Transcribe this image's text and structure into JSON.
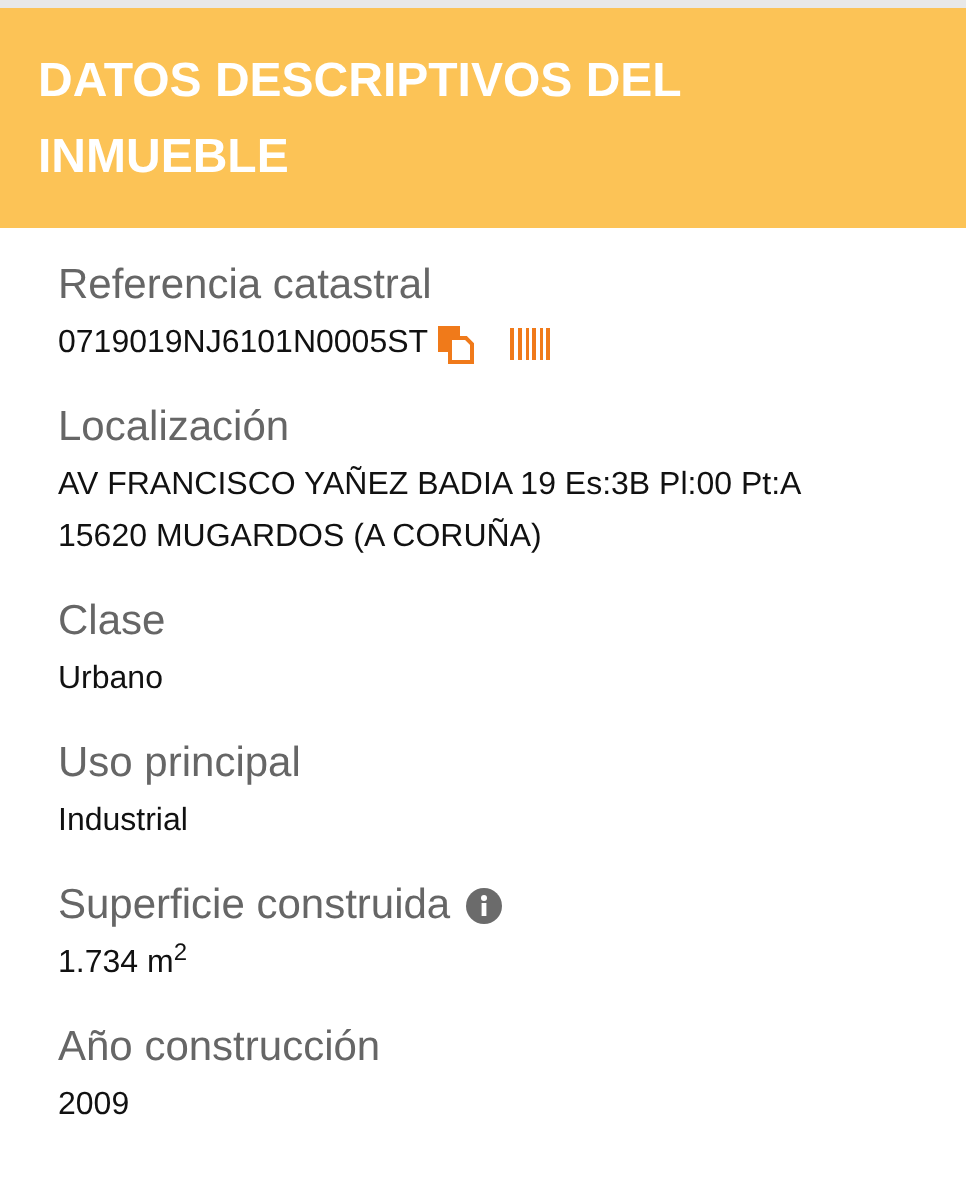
{
  "header": {
    "title": "DATOS DESCRIPTIVOS DEL INMUEBLE"
  },
  "fields": [
    {
      "label": "Referencia catastral",
      "lines": [
        "0719019NJ6101N0005ST"
      ],
      "icons": [
        {
          "kind": "copy"
        },
        {
          "kind": "barcode"
        }
      ]
    },
    {
      "label": "Localización",
      "lines": [
        "AV FRANCISCO YAÑEZ BADIA 19 Es:3B Pl:00 Pt:A",
        "15620 MUGARDOS (A CORUÑA)"
      ]
    },
    {
      "label": "Clase",
      "lines": [
        "Urbano"
      ]
    },
    {
      "label": "Uso principal",
      "lines": [
        "Industrial"
      ]
    },
    {
      "label": "Superficie construida",
      "lines": [
        "1.734 m$^{2}$"
      ],
      "label_icons": [
        {
          "kind": "info"
        }
      ]
    },
    {
      "label": "Año construcción",
      "lines": [
        "2009"
      ]
    }
  ]
}
